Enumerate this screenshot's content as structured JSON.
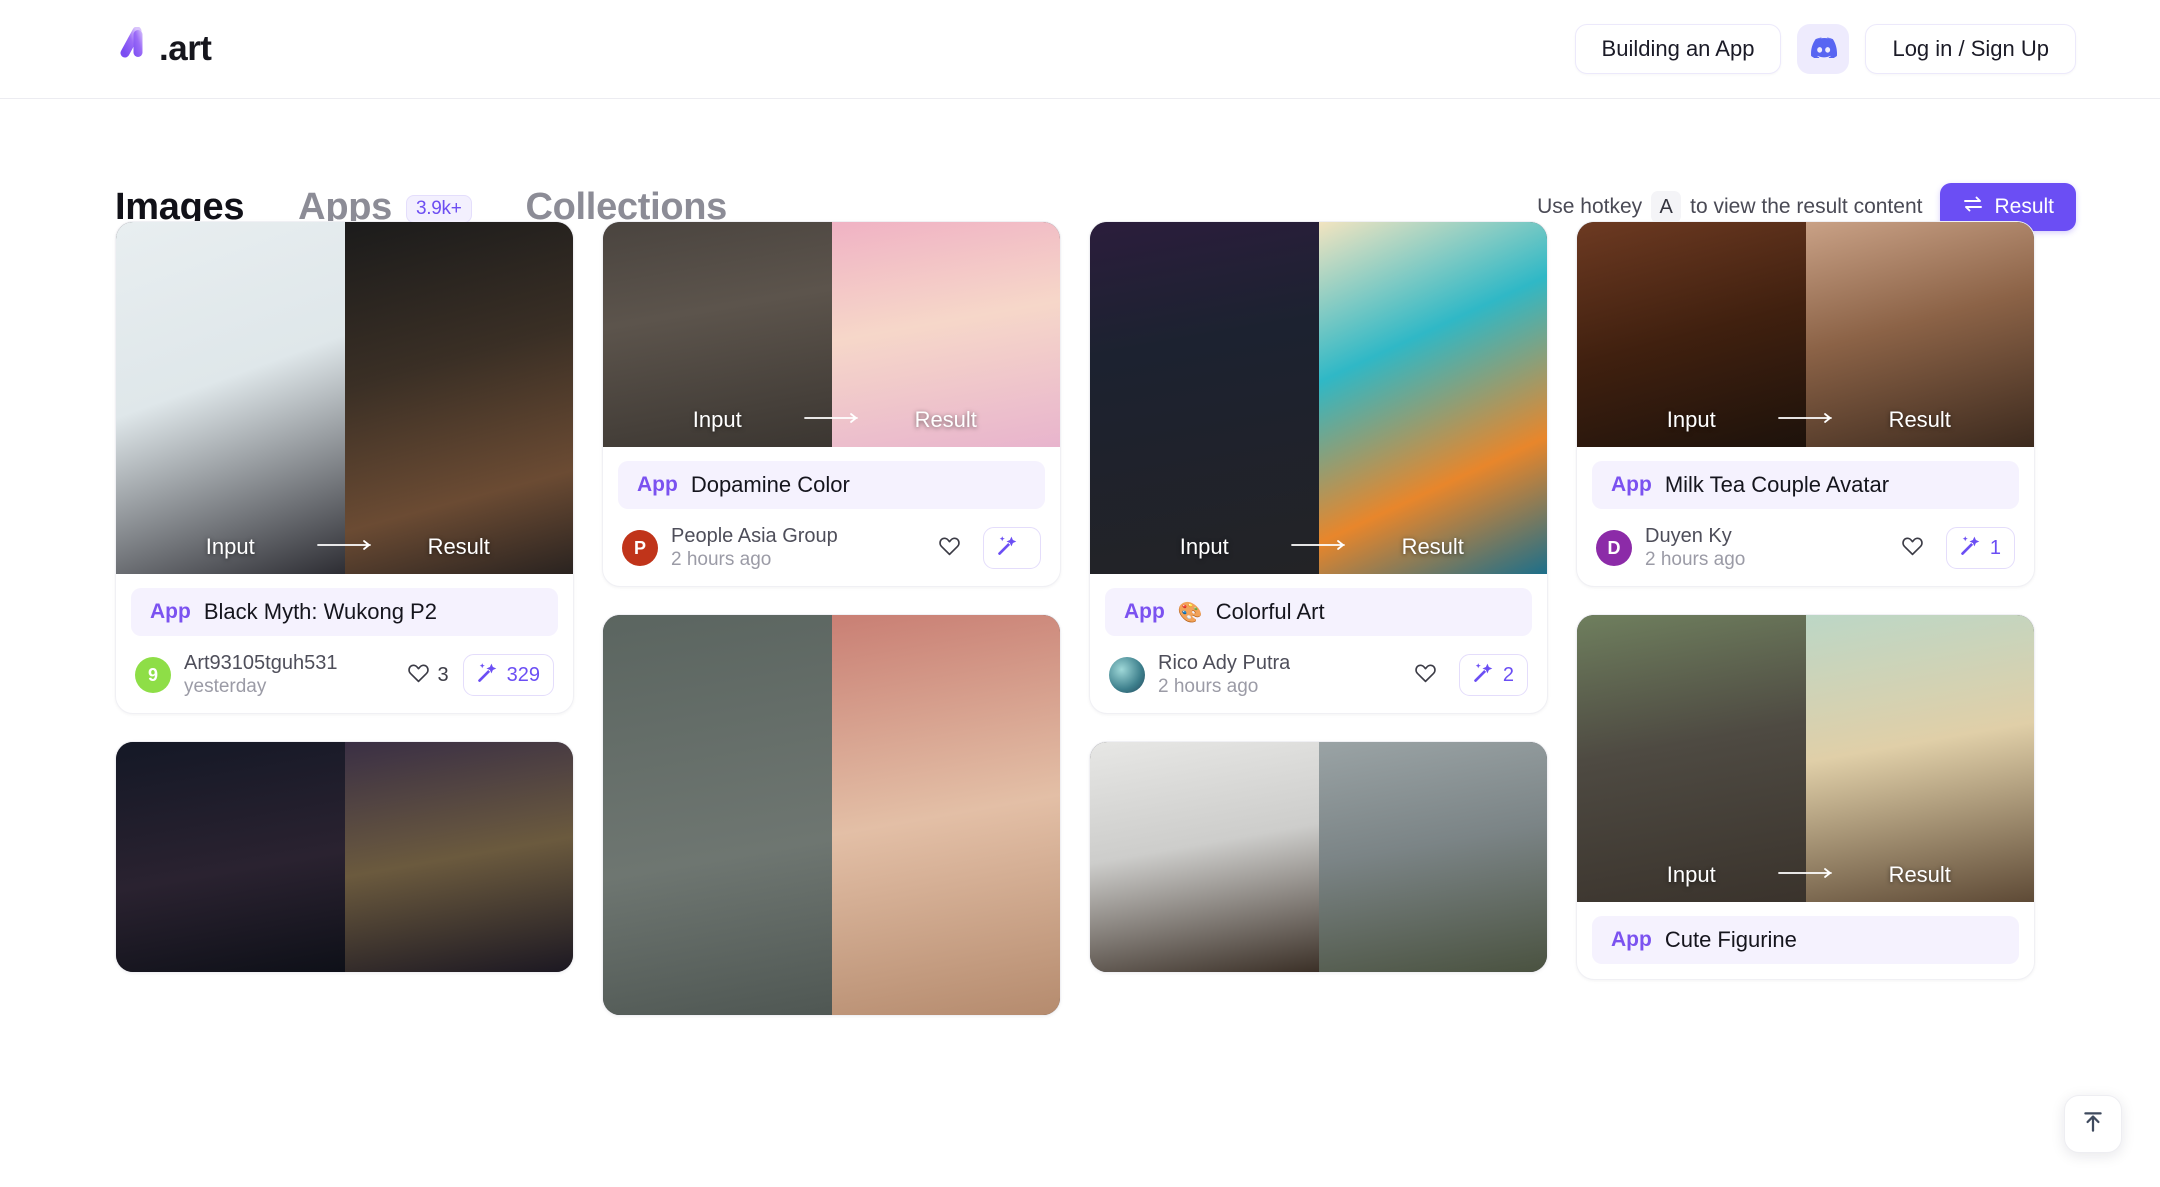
{
  "header": {
    "logo_text": ".art",
    "logo_icon": "a-art-logo-icon",
    "building_app_label": "Building an App",
    "discord_icon": "discord-icon",
    "login_label": "Log in / Sign Up"
  },
  "tabs": [
    {
      "label": "Images",
      "active": true,
      "badge": ""
    },
    {
      "label": "Apps",
      "active": false,
      "badge": "3.9k+"
    },
    {
      "label": "Collections",
      "active": false,
      "badge": ""
    }
  ],
  "toolbar": {
    "hotkey_prefix": "Use hotkey",
    "hotkey_key": "A",
    "hotkey_suffix": "to view the result content",
    "result_label": "Result",
    "result_icon": "swap-arrows-icon",
    "accent_color": "#6b4ef4"
  },
  "media_labels": {
    "input": "Input",
    "result": "Result",
    "arrow_icon": "arrow-right-icon"
  },
  "cards": [
    {
      "app_tag": "App",
      "app_name": "Black Myth: Wukong P2",
      "app_emoji": "",
      "author": "Art93105tguh531",
      "time": "yesterday",
      "avatar_text": "9",
      "avatar_color": "#8ede47",
      "likes": "3",
      "generations": "329",
      "media_height": 352,
      "input_bg": "linear-gradient(160deg,#e8eef0 0%,#dfe7ea 45%,#2d2d33 100%)",
      "result_bg": "linear-gradient(165deg,#1b1b1b 0%,#3a2f25 40%,#6b4b33 75%,#2a2320 100%)"
    },
    {
      "app_tag": "App",
      "app_name": "Dopamine Color",
      "app_emoji": "",
      "author": "People Asia Group",
      "time": "2 hours ago",
      "avatar_text": "P",
      "avatar_color": "#c0341a",
      "likes": "",
      "generations": "",
      "media_height": 225,
      "input_bg": "linear-gradient(170deg,#4a443f 0%,#5c544c 40%,#3b3631 100%)",
      "result_bg": "linear-gradient(170deg,#f0b2c4 0%,#f6d7c9 45%,#e8b4cd 100%)"
    },
    {
      "app_tag": "App",
      "app_name": "Colorful Art",
      "app_emoji": "🎨",
      "author": "Rico Ady Putra",
      "time": "2 hours ago",
      "avatar_text": "",
      "avatar_color": "#4d9aa3",
      "likes": "",
      "generations": "2",
      "media_height": 352,
      "input_bg": "linear-gradient(170deg,#2b1d3c 0%,#1c2230 35%,#232326 100%)",
      "result_bg": "linear-gradient(155deg,#f2e4c0 0%,#2fb8c6 35%,#e8862b 70%,#1d6f8a 100%)"
    },
    {
      "app_tag": "App",
      "app_name": "Milk Tea Couple Avatar",
      "app_emoji": "",
      "author": "Duyen Ky",
      "time": "2 hours ago",
      "avatar_text": "D",
      "avatar_color": "#8c2ba8",
      "likes": "",
      "generations": "1",
      "media_height": 225,
      "input_bg": "linear-gradient(165deg,#6d3a22 0%,#40200f 50%,#1d120b 100%)",
      "result_bg": "linear-gradient(165deg,#c9a186 0%,#8c6347 45%,#3c2a1e 100%)"
    },
    {
      "app_tag": "App",
      "app_name": "Cute Figurine",
      "app_emoji": "",
      "author": "",
      "time": "",
      "avatar_text": "",
      "avatar_color": "#777",
      "likes": "",
      "generations": "",
      "media_height": 225,
      "input_bg": "linear-gradient(170deg,#6f7f5e 0%,#4e4a42 45%,#3a332c 100%)",
      "result_bg": "linear-gradient(170deg,#bcd7c6 0%,#e0cfa8 45%,#5e4a36 100%)"
    },
    {
      "app_tag": "",
      "app_name": "",
      "app_emoji": "",
      "author": "",
      "time": "",
      "avatar_text": "",
      "avatar_color": "#777",
      "likes": "",
      "generations": "",
      "media_height": 230,
      "input_bg": "linear-gradient(170deg,#141826 0%,#2a2230 55%,#0e1018 100%)",
      "result_bg": "linear-gradient(170deg,#3a2f45 0%,#6b5a3e 50%,#1c1822 100%)"
    },
    {
      "app_tag": "",
      "app_name": "",
      "app_emoji": "",
      "author": "",
      "time": "",
      "avatar_text": "",
      "avatar_color": "#777",
      "likes": "",
      "generations": "",
      "media_height": 230,
      "input_bg": "linear-gradient(170deg,#5b6560 0%,#6e7671 60%,#4f5753 100%)",
      "result_bg": "linear-gradient(170deg,#c97f74 0%,#e3bfa6 50%,#b58b6e 100%)"
    },
    {
      "app_tag": "",
      "app_name": "",
      "app_emoji": "",
      "author": "",
      "time": "",
      "avatar_text": "",
      "avatar_color": "#777",
      "likes": "",
      "generations": "",
      "media_height": 225,
      "input_bg": "linear-gradient(170deg,#e7e7e5 0%,#cdcdcb 45%,#3b3027 100%)",
      "result_bg": "linear-gradient(170deg,#9aa3a5 0%,#7b8486 45%,#4a5240 100%)"
    }
  ],
  "scroll_top": {
    "icon": "scroll-to-top-icon"
  }
}
